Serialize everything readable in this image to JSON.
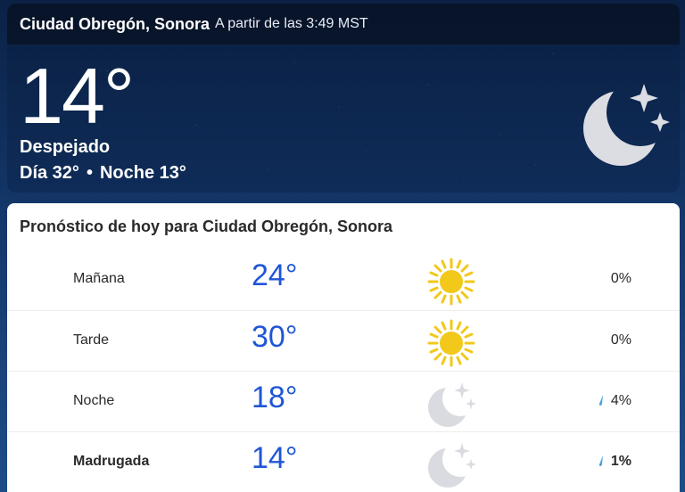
{
  "header": {
    "location": "Ciudad Obregón, Sonora",
    "as_of": "A partir de las 3:49 MST",
    "temperature": "14°",
    "condition": "Despejado",
    "day_label": "Día 32°",
    "separator": "•",
    "night_label": "Noche 13°",
    "condition_icon": "moon-stars-icon"
  },
  "forecast": {
    "title": "Pronóstico de hoy para Ciudad Obregón, Sonora",
    "rows": [
      {
        "label": "Mañana",
        "temp": "24°",
        "icon": "sun-icon",
        "precip": "0%"
      },
      {
        "label": "Tarde",
        "temp": "30°",
        "icon": "sun-icon",
        "precip": "0%"
      },
      {
        "label": "Noche",
        "temp": "18°",
        "icon": "moon-stars-icon",
        "precip": "4%"
      },
      {
        "label": "Madrugada",
        "temp": "14°",
        "icon": "moon-stars-icon",
        "precip": "1%"
      }
    ]
  },
  "colors": {
    "temp_blue": "#1f56d6",
    "sun_yellow": "#f2c81a",
    "moon_gray": "#d9dbe0",
    "drop_blue": "#4aa3e0"
  }
}
